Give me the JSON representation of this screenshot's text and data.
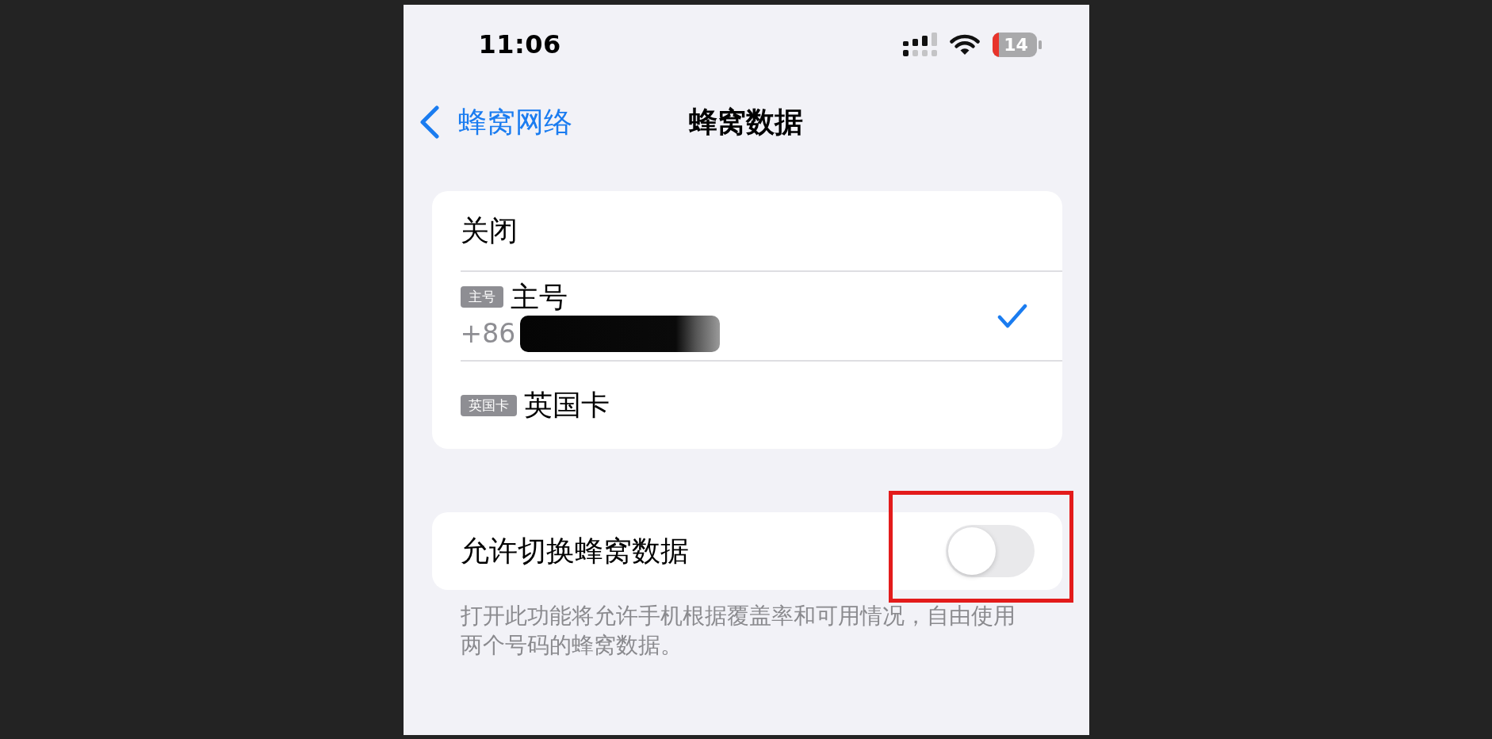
{
  "status_bar": {
    "time": "11:06",
    "battery": "14"
  },
  "nav_bar": {
    "back": "蜂窝网络",
    "title": "蜂窝数据"
  },
  "options": [
    {
      "label": "关闭",
      "selected": false
    },
    {
      "badge": "主号",
      "label": "主号",
      "number": "+86",
      "number_redacted": true,
      "selected": true
    },
    {
      "badge": "英国卡",
      "label": "英国卡",
      "selected": false
    }
  ],
  "switch_setting": {
    "label": "允许切换蜂窝数据",
    "on": false,
    "highlighted": true
  },
  "footer": "打开此功能将允许手机根据覆盖率和可用情况，自由使用两个号码的蜂窝数据。"
}
